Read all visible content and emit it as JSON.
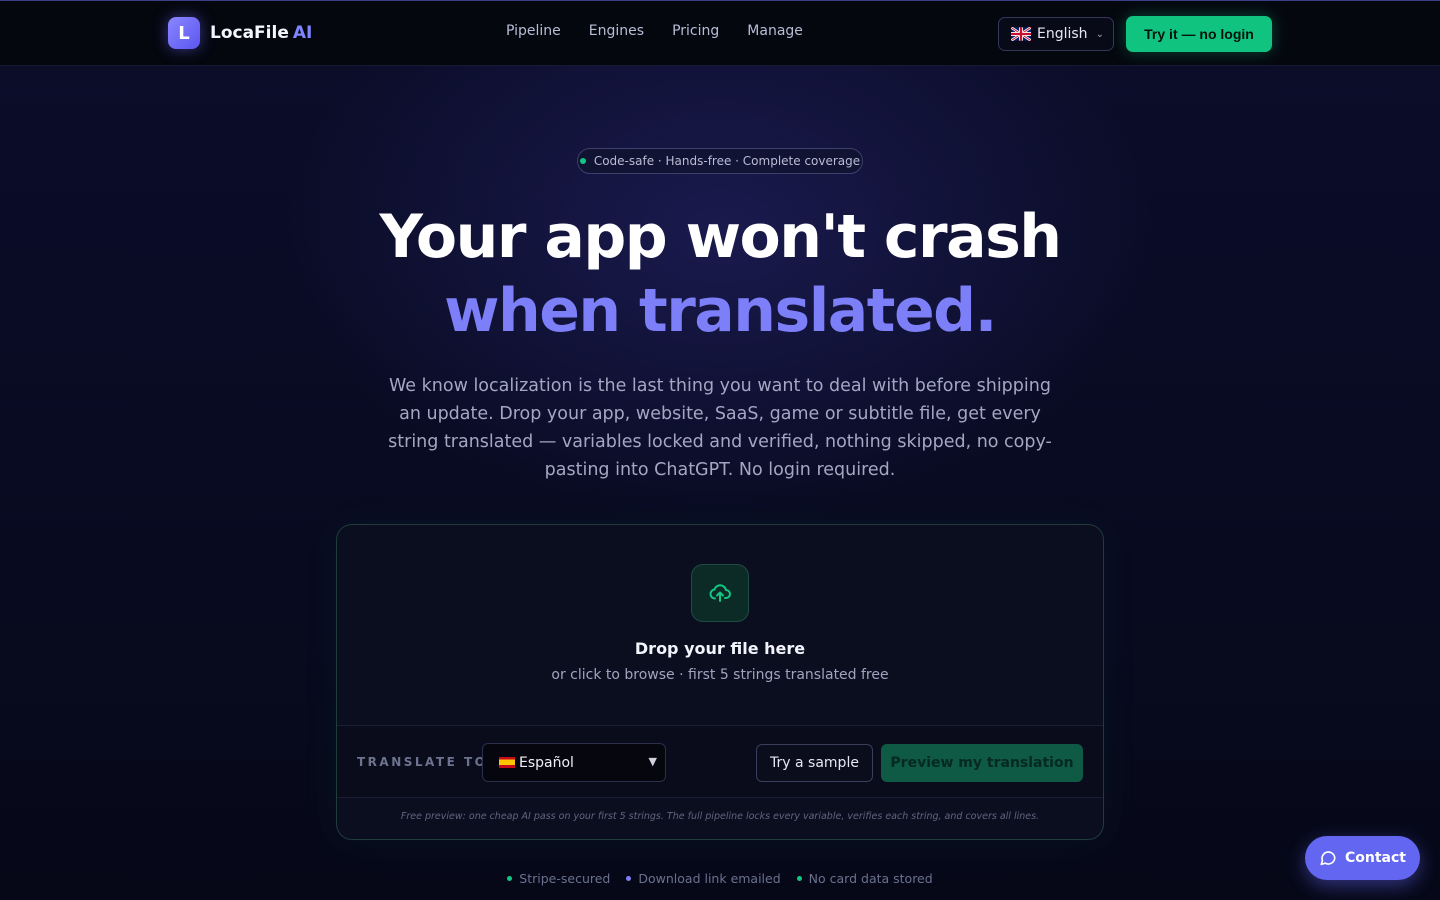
{
  "brand": {
    "name": "LocaFile",
    "suffix": "AI",
    "logo_letter": "L"
  },
  "nav": {
    "links": [
      "Pipeline",
      "Engines",
      "Pricing",
      "Manage"
    ],
    "language": "English",
    "cta": "Try it — no login"
  },
  "hero": {
    "badge": "Code-safe · Hands-free · Complete coverage",
    "title_line1": "Your app won't crash",
    "title_line2": "when translated.",
    "description": "We know localization is the last thing you want to deal with before shipping an update. Drop your app, website, SaaS, game or subtitle file, get every string translated — variables locked and verified, nothing skipped, no copy-pasting into ChatGPT. No login required."
  },
  "dropzone": {
    "title": "Drop your file here",
    "subtitle": "or click to browse · first 5 strings translated free",
    "translate_label": "TRANSLATE TO",
    "selected_language": "Español",
    "sample_button": "Try a sample",
    "preview_button": "Preview my translation",
    "fineprint": "Free preview: one cheap AI pass on your first 5 strings. The full pipeline locks every variable, verifies each string, and covers all lines."
  },
  "trust": [
    {
      "label": "Stripe-secured",
      "color": "#12c784"
    },
    {
      "label": "Download link emailed",
      "color": "#7c7ff7"
    },
    {
      "label": "No card data stored",
      "color": "#12c784"
    }
  ],
  "contact": {
    "label": "Contact"
  },
  "colors": {
    "accent": "#7c7ff7",
    "cta_green": "#10c47f",
    "contact": "#6266f1"
  }
}
